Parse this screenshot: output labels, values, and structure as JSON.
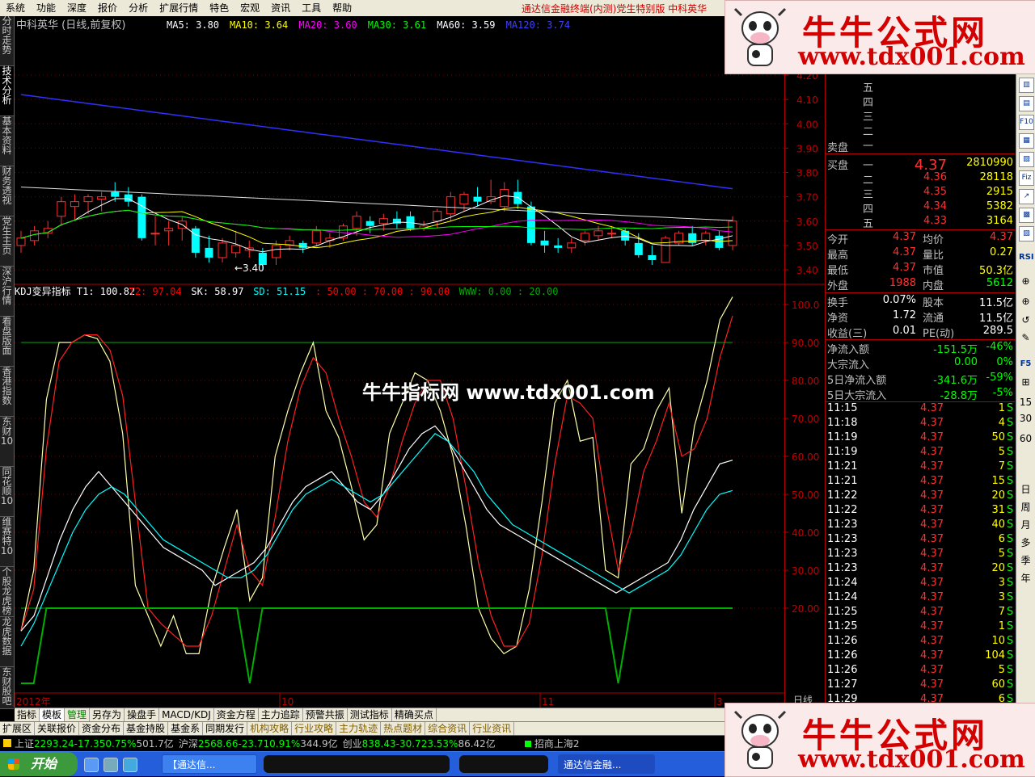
{
  "menu": [
    "系统",
    "功能",
    "深度",
    "报价",
    "分析",
    "扩展行情",
    "特色",
    "宏观",
    "资讯",
    "工具",
    "帮助"
  ],
  "menu_notice": "通达信金融终端(内测)党生特别版   中科英华",
  "stock_title": "中科英华 (日线,前复权)",
  "ma_legend": [
    {
      "label": "MA5:",
      "value": "3.80",
      "color": "#ffffff"
    },
    {
      "label": "MA10:",
      "value": "3.64",
      "color": "#ffff00"
    },
    {
      "label": "MA20:",
      "value": "3.60",
      "color": "#ff00ff"
    },
    {
      "label": "MA30:",
      "value": "3.61",
      "color": "#00ff00"
    },
    {
      "label": "MA60:",
      "value": "3.59",
      "color": "#ffffff"
    },
    {
      "label": "MA120:",
      "value": "3.74",
      "color": "#4040ff"
    }
  ],
  "kdj_legend": [
    {
      "text": "KDJ变异指标 T1: 100.82",
      "color": "#ffffff"
    },
    {
      "text": "T2: 97.04",
      "color": "#ff0000"
    },
    {
      "text": "SK: 58.97",
      "color": "#ffffff"
    },
    {
      "text": "SD: 51.15",
      "color": "#00ffff"
    },
    {
      "text": ": 50.00 : 70.00 : 90.00",
      "color": "#ff0000"
    },
    {
      "text": "WWW: 0.00 : 20.00",
      "color": "#00aa00"
    }
  ],
  "low_annotation": "←3.40",
  "left_tabs": [
    "分时走势",
    "技术分析",
    "基本资料",
    "财务透视",
    "党生主页",
    "深沪行情",
    "看盘版面",
    "香港指数",
    "东财10",
    "同花顺10",
    "维赛特10",
    "个股龙虎榜",
    "龙虎数据",
    "东财股吧"
  ],
  "price_scale": [
    "4.20",
    "4.10",
    "4.00",
    "3.90",
    "3.80",
    "3.70",
    "3.60",
    "3.50",
    "3.40"
  ],
  "kdj_scale": [
    "100.0",
    "90.00",
    "80.00",
    "70.00",
    "60.00",
    "50.00",
    "40.00",
    "30.00",
    "20.00"
  ],
  "date_labels": [
    "2012年",
    "10",
    "11",
    "3"
  ],
  "date_scale_label": "日线",
  "order_book": {
    "sell_label": "卖盘",
    "buy_label": "买盘",
    "sell_levels": [
      "五",
      "四",
      "三",
      "二",
      "一"
    ],
    "buy_levels": [
      {
        "lvl": "一",
        "price": "4.37",
        "vol": "2810990"
      },
      {
        "lvl": "二",
        "price": "4.36",
        "vol": "28118"
      },
      {
        "lvl": "三",
        "price": "4.35",
        "vol": "2915"
      },
      {
        "lvl": "四",
        "price": "4.34",
        "vol": "5382"
      },
      {
        "lvl": "五",
        "price": "4.33",
        "vol": "3164"
      }
    ]
  },
  "stats": [
    {
      "l1": "今开",
      "v1": "4.37",
      "l2": "均价",
      "v2": "4.37",
      "c1": "#ff3030",
      "c2": "#ff3030"
    },
    {
      "l1": "最高",
      "v1": "4.37",
      "l2": "量比",
      "v2": "0.27",
      "c1": "#ff3030",
      "c2": "#ffff00"
    },
    {
      "l1": "最低",
      "v1": "4.37",
      "l2": "市值",
      "v2": "50.3亿",
      "c1": "#ff3030",
      "c2": "#ffff00"
    },
    {
      "l1": "外盘",
      "v1": "1988",
      "l2": "内盘",
      "v2": "5612",
      "c1": "#ff3030",
      "c2": "#00ff00"
    },
    {
      "l1": "换手",
      "v1": "0.07%",
      "l2": "股本",
      "v2": "11.5亿",
      "c1": "#ffffff",
      "c2": "#ffffff"
    },
    {
      "l1": "净资",
      "v1": "1.72",
      "l2": "流通",
      "v2": "11.5亿",
      "c1": "#ffffff",
      "c2": "#ffffff"
    },
    {
      "l1": "收益(三)",
      "v1": "0.01",
      "l2": "PE(动)",
      "v2": "289.5",
      "c1": "#ffffff",
      "c2": "#ffffff"
    }
  ],
  "flows": [
    {
      "label": "净流入额",
      "value": "-151.5万",
      "pct": "-46%"
    },
    {
      "label": "大宗流入",
      "value": "0.00",
      "pct": "0%"
    },
    {
      "label": "5日净流入额",
      "value": "-341.6万",
      "pct": "-59%"
    },
    {
      "label": "5日大宗流入",
      "value": "-28.8万",
      "pct": "-5%"
    }
  ],
  "ticks": [
    {
      "t": "11:15",
      "p": "4.37",
      "v": "1",
      "s": "S"
    },
    {
      "t": "11:18",
      "p": "4.37",
      "v": "4",
      "s": "S"
    },
    {
      "t": "11:19",
      "p": "4.37",
      "v": "50",
      "s": "S"
    },
    {
      "t": "11:19",
      "p": "4.37",
      "v": "5",
      "s": "S"
    },
    {
      "t": "11:21",
      "p": "4.37",
      "v": "7",
      "s": "S"
    },
    {
      "t": "11:21",
      "p": "4.37",
      "v": "15",
      "s": "S"
    },
    {
      "t": "11:22",
      "p": "4.37",
      "v": "20",
      "s": "S"
    },
    {
      "t": "11:22",
      "p": "4.37",
      "v": "31",
      "s": "S"
    },
    {
      "t": "11:23",
      "p": "4.37",
      "v": "40",
      "s": "S"
    },
    {
      "t": "11:23",
      "p": "4.37",
      "v": "6",
      "s": "S"
    },
    {
      "t": "11:23",
      "p": "4.37",
      "v": "5",
      "s": "S"
    },
    {
      "t": "11:23",
      "p": "4.37",
      "v": "20",
      "s": "S"
    },
    {
      "t": "11:24",
      "p": "4.37",
      "v": "3",
      "s": "S"
    },
    {
      "t": "11:24",
      "p": "4.37",
      "v": "3",
      "s": "S"
    },
    {
      "t": "11:25",
      "p": "4.37",
      "v": "7",
      "s": "S"
    },
    {
      "t": "11:25",
      "p": "4.37",
      "v": "1",
      "s": "S"
    },
    {
      "t": "11:26",
      "p": "4.37",
      "v": "10",
      "s": "S"
    },
    {
      "t": "11:26",
      "p": "4.37",
      "v": "104",
      "s": "S"
    },
    {
      "t": "11:26",
      "p": "4.37",
      "v": "5",
      "s": "S"
    },
    {
      "t": "11:27",
      "p": "4.37",
      "v": "60",
      "s": "S"
    },
    {
      "t": "11:29",
      "p": "4.37",
      "v": "6",
      "s": "S"
    }
  ],
  "right_tools": [
    "RSI",
    "F5",
    "日",
    "周",
    "月",
    "多",
    "季",
    "年"
  ],
  "tabs_row1": [
    "指标",
    "模板",
    "管理",
    "另存为",
    "操盘手",
    "MACD/KDJ",
    "资金方程",
    "主力追踪",
    "预警共振",
    "测试指标",
    "精确买点"
  ],
  "tabs_row2": [
    "扩展区",
    "关联报价",
    "资金分布",
    "基金持股",
    "基金系",
    "同期发行",
    "机构攻略",
    "行业攻略",
    "主力轨迹",
    "热点题材",
    "综合资讯",
    "行业资讯"
  ],
  "index_bar": [
    {
      "name": "上证",
      "value": "2293.24",
      "chg": "-17.35",
      "pct": "0.75%",
      "amt": "501.7亿"
    },
    {
      "name": "沪深",
      "value": "2568.66",
      "chg": "-23.71",
      "pct": "0.91%",
      "amt": "344.9亿"
    },
    {
      "name": "创业",
      "value": "838.43",
      "chg": "-30.72",
      "pct": "3.53%",
      "amt": "86.42亿"
    }
  ],
  "index_broker": "招商上海2",
  "taskbar": {
    "start": "开始",
    "items": [
      "【通达信...",
      "通达信金融..."
    ]
  },
  "watermark": {
    "brand": "牛牛公式网",
    "url": "www.tdx001.com",
    "center": "牛牛指标网 www.tdx001.com"
  },
  "chart_data": [
    {
      "type": "candlestick",
      "title": "中科英华 (日线,前复权)",
      "ylim": [
        3.35,
        4.2
      ],
      "ylabel": "",
      "candles": [
        {
          "o": 3.5,
          "h": 3.56,
          "l": 3.47,
          "c": 3.53
        },
        {
          "o": 3.52,
          "h": 3.58,
          "l": 3.5,
          "c": 3.56
        },
        {
          "o": 3.55,
          "h": 3.6,
          "l": 3.53,
          "c": 3.57
        },
        {
          "o": 3.62,
          "h": 3.7,
          "l": 3.58,
          "c": 3.68
        },
        {
          "o": 3.66,
          "h": 3.71,
          "l": 3.6,
          "c": 3.68
        },
        {
          "o": 3.68,
          "h": 3.71,
          "l": 3.63,
          "c": 3.7
        },
        {
          "o": 3.69,
          "h": 3.72,
          "l": 3.64,
          "c": 3.7
        },
        {
          "o": 3.72,
          "h": 3.76,
          "l": 3.68,
          "c": 3.7
        },
        {
          "o": 3.71,
          "h": 3.74,
          "l": 3.66,
          "c": 3.68
        },
        {
          "o": 3.7,
          "h": 3.71,
          "l": 3.52,
          "c": 3.53
        },
        {
          "o": 3.55,
          "h": 3.62,
          "l": 3.5,
          "c": 3.55
        },
        {
          "o": 3.56,
          "h": 3.6,
          "l": 3.5,
          "c": 3.57
        },
        {
          "o": 3.57,
          "h": 3.62,
          "l": 3.52,
          "c": 3.6
        },
        {
          "o": 3.57,
          "h": 3.58,
          "l": 3.45,
          "c": 3.47
        },
        {
          "o": 3.49,
          "h": 3.54,
          "l": 3.43,
          "c": 3.45
        },
        {
          "o": 3.45,
          "h": 3.53,
          "l": 3.43,
          "c": 3.51
        },
        {
          "o": 3.47,
          "h": 3.56,
          "l": 3.45,
          "c": 3.5
        },
        {
          "o": 3.48,
          "h": 3.52,
          "l": 3.45,
          "c": 3.49
        },
        {
          "o": 3.47,
          "h": 3.49,
          "l": 3.4,
          "c": 3.42
        },
        {
          "o": 3.45,
          "h": 3.52,
          "l": 3.42,
          "c": 3.5
        },
        {
          "o": 3.5,
          "h": 3.54,
          "l": 3.48,
          "c": 3.52
        },
        {
          "o": 3.51,
          "h": 3.52,
          "l": 3.47,
          "c": 3.49
        },
        {
          "o": 3.51,
          "h": 3.58,
          "l": 3.5,
          "c": 3.56
        },
        {
          "o": 3.52,
          "h": 3.55,
          "l": 3.49,
          "c": 3.53
        },
        {
          "o": 3.53,
          "h": 3.59,
          "l": 3.52,
          "c": 3.58
        },
        {
          "o": 3.57,
          "h": 3.64,
          "l": 3.54,
          "c": 3.62
        },
        {
          "o": 3.6,
          "h": 3.62,
          "l": 3.55,
          "c": 3.58
        },
        {
          "o": 3.59,
          "h": 3.63,
          "l": 3.56,
          "c": 3.61
        },
        {
          "o": 3.61,
          "h": 3.64,
          "l": 3.57,
          "c": 3.59
        },
        {
          "o": 3.62,
          "h": 3.64,
          "l": 3.56,
          "c": 3.57
        },
        {
          "o": 3.57,
          "h": 3.6,
          "l": 3.56,
          "c": 3.58
        },
        {
          "o": 3.6,
          "h": 3.65,
          "l": 3.57,
          "c": 3.64
        },
        {
          "o": 3.63,
          "h": 3.72,
          "l": 3.6,
          "c": 3.7
        },
        {
          "o": 3.67,
          "h": 3.72,
          "l": 3.64,
          "c": 3.71
        },
        {
          "o": 3.7,
          "h": 3.74,
          "l": 3.66,
          "c": 3.68
        },
        {
          "o": 3.68,
          "h": 3.77,
          "l": 3.67,
          "c": 3.7
        },
        {
          "o": 3.66,
          "h": 3.76,
          "l": 3.64,
          "c": 3.73
        },
        {
          "o": 3.72,
          "h": 3.77,
          "l": 3.65,
          "c": 3.67
        },
        {
          "o": 3.66,
          "h": 3.68,
          "l": 3.5,
          "c": 3.51
        },
        {
          "o": 3.52,
          "h": 3.56,
          "l": 3.47,
          "c": 3.5
        },
        {
          "o": 3.5,
          "h": 3.53,
          "l": 3.47,
          "c": 3.49
        },
        {
          "o": 3.49,
          "h": 3.53,
          "l": 3.47,
          "c": 3.51
        },
        {
          "o": 3.52,
          "h": 3.56,
          "l": 3.5,
          "c": 3.55
        },
        {
          "o": 3.54,
          "h": 3.58,
          "l": 3.52,
          "c": 3.56
        },
        {
          "o": 3.55,
          "h": 3.58,
          "l": 3.53,
          "c": 3.55
        },
        {
          "o": 3.56,
          "h": 3.57,
          "l": 3.5,
          "c": 3.52
        },
        {
          "o": 3.51,
          "h": 3.55,
          "l": 3.45,
          "c": 3.46
        },
        {
          "o": 3.46,
          "h": 3.5,
          "l": 3.42,
          "c": 3.44
        },
        {
          "o": 3.43,
          "h": 3.54,
          "l": 3.43,
          "c": 3.53
        },
        {
          "o": 3.51,
          "h": 3.56,
          "l": 3.5,
          "c": 3.55
        },
        {
          "o": 3.55,
          "h": 3.58,
          "l": 3.5,
          "c": 3.51
        },
        {
          "o": 3.52,
          "h": 3.56,
          "l": 3.5,
          "c": 3.55
        },
        {
          "o": 3.54,
          "h": 3.56,
          "l": 3.48,
          "c": 3.49
        },
        {
          "o": 3.5,
          "h": 3.62,
          "l": 3.48,
          "c": 3.6
        }
      ]
    },
    {
      "type": "line",
      "title": "KDJ变异指标",
      "ylim": [
        0,
        105
      ],
      "reference_lines": [
        90,
        20
      ],
      "series": [
        {
          "name": "T1",
          "color": "#ffffaa",
          "values": [
            14,
            30,
            75,
            90,
            90,
            92,
            91,
            85,
            66,
            26,
            18,
            10,
            18,
            8,
            8,
            25,
            36,
            46,
            22,
            28,
            60,
            72,
            82,
            90,
            72,
            65,
            52,
            38,
            42,
            66,
            74,
            82,
            80,
            72,
            60,
            42,
            20,
            12,
            8,
            10,
            25,
            48,
            74,
            80,
            64,
            65,
            30,
            28,
            58,
            62,
            72,
            78,
            45,
            68,
            80,
            96,
            102
          ]
        },
        {
          "name": "T2",
          "color": "#ff2020",
          "values": [
            14,
            25,
            62,
            85,
            90,
            92,
            92,
            88,
            76,
            48,
            20,
            16,
            13,
            10,
            10,
            18,
            30,
            42,
            30,
            26,
            44,
            64,
            78,
            86,
            82,
            70,
            60,
            48,
            44,
            52,
            64,
            74,
            80,
            80,
            70,
            52,
            32,
            18,
            10,
            10,
            16,
            34,
            58,
            76,
            74,
            70,
            48,
            30,
            40,
            56,
            64,
            74,
            60,
            62,
            70,
            86,
            97
          ]
        },
        {
          "name": "SK",
          "color": "#ffffff",
          "values": [
            14,
            18,
            28,
            38,
            46,
            52,
            56,
            52,
            48,
            44,
            40,
            36,
            34,
            32,
            30,
            26,
            28,
            30,
            32,
            36,
            42,
            48,
            52,
            54,
            56,
            52,
            48,
            46,
            50,
            56,
            62,
            66,
            68,
            64,
            58,
            52,
            46,
            42,
            40,
            38,
            36,
            34,
            32,
            30,
            28,
            26,
            24,
            26,
            28,
            30,
            32,
            38,
            46,
            52,
            58,
            59
          ]
        },
        {
          "name": "SD",
          "color": "#00ffff",
          "values": [
            10,
            16,
            24,
            32,
            40,
            46,
            50,
            52,
            50,
            46,
            42,
            38,
            36,
            34,
            32,
            30,
            28,
            28,
            30,
            34,
            40,
            46,
            50,
            52,
            54,
            52,
            50,
            48,
            50,
            54,
            58,
            62,
            66,
            64,
            60,
            56,
            50,
            46,
            42,
            40,
            38,
            36,
            34,
            32,
            30,
            28,
            26,
            24,
            26,
            28,
            30,
            34,
            40,
            46,
            50,
            51
          ]
        },
        {
          "name": "WWW",
          "color": "#00b000",
          "values": [
            0,
            0,
            20,
            20,
            20,
            20,
            20,
            20,
            20,
            20,
            20,
            20,
            20,
            20,
            20,
            20,
            20,
            20,
            0,
            20,
            20,
            20,
            20,
            20,
            20,
            20,
            20,
            20,
            20,
            20,
            20,
            20,
            20,
            20,
            20,
            20,
            20,
            20,
            20,
            20,
            20,
            20,
            20,
            20,
            20,
            20,
            20,
            0,
            20,
            20,
            20,
            20,
            20,
            20,
            20,
            20,
            20
          ]
        }
      ]
    }
  ]
}
